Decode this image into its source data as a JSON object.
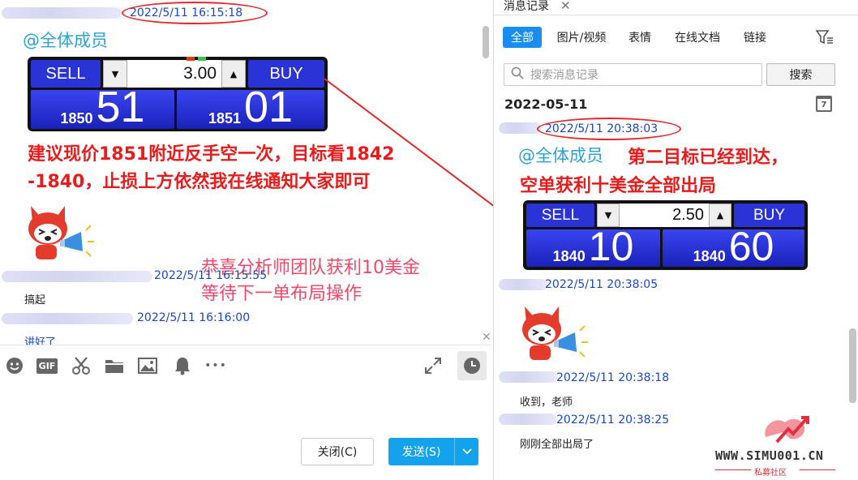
{
  "left": {
    "msg1": {
      "timestamp": "2022/5/11 16:15:18",
      "mention": "@全体成员"
    },
    "ticket1": {
      "sell_label": "SELL",
      "buy_label": "BUY",
      "qty": "3.00",
      "sell_small": "1850",
      "sell_big": "51",
      "buy_small": "1851",
      "buy_big": "01"
    },
    "overlay": {
      "red_line1": "建议现价1851附近反手空一次，目标看1842",
      "red_line2": "-1840，止损上方依然我在线通知大家即可",
      "pink_line1": "恭喜分析师团队获利10美金",
      "pink_line2": "等待下一单布局操作"
    },
    "msg2": {
      "timestamp": "2022/5/11 16:15:55",
      "text": "搞起"
    },
    "msg3": {
      "timestamp": "2022/5/11 16:16:00",
      "text": "讲好了"
    },
    "toolbar": {
      "icons": [
        "emoji-icon",
        "gif-icon",
        "scissors-icon",
        "folder-icon",
        "image-icon",
        "bell-icon",
        "more-icon"
      ],
      "gif_label": "GIF",
      "more_glyph": "•••"
    },
    "buttons": {
      "close_label": "关闭(C)",
      "send_label": "发送(S)"
    }
  },
  "right": {
    "tab_title": "消息记录",
    "filters": [
      "全部",
      "图片/视频",
      "表情",
      "在线文档",
      "链接"
    ],
    "active_filter": 0,
    "search": {
      "placeholder": "搜索消息记录",
      "button": "搜索"
    },
    "date_header": "2022-05-11",
    "calendar_day": "7",
    "msg1": {
      "timestamp": "2022/5/11 20:38:03",
      "mention": "@全体成员",
      "red_line1": "第二目标已经到达，",
      "red_line2": "空单获利十美金全部出局"
    },
    "ticket2": {
      "sell_label": "SELL",
      "buy_label": "BUY",
      "qty": "2.50",
      "sell_small": "1840",
      "sell_big": "10",
      "buy_small": "1840",
      "buy_big": "60"
    },
    "msg2": {
      "timestamp": "2022/5/11 20:38:05"
    },
    "msg3": {
      "timestamp": "2022/5/11 20:38:18",
      "text": "收到，老师"
    },
    "msg4": {
      "timestamp": "2022/5/11 20:38:25",
      "text": "刚刚全部出局了"
    }
  },
  "watermark": {
    "site": "WWW.SIMU001.CN",
    "sub": "私募社区"
  },
  "colors": {
    "accent": "#1a8ef0",
    "send": "#12a3ec",
    "timestamp": "#1a47c8",
    "mention": "#2aa3d8",
    "red": "#e81c1c",
    "pink": "#f0486a",
    "ticket_blue": "#2a33d6"
  }
}
